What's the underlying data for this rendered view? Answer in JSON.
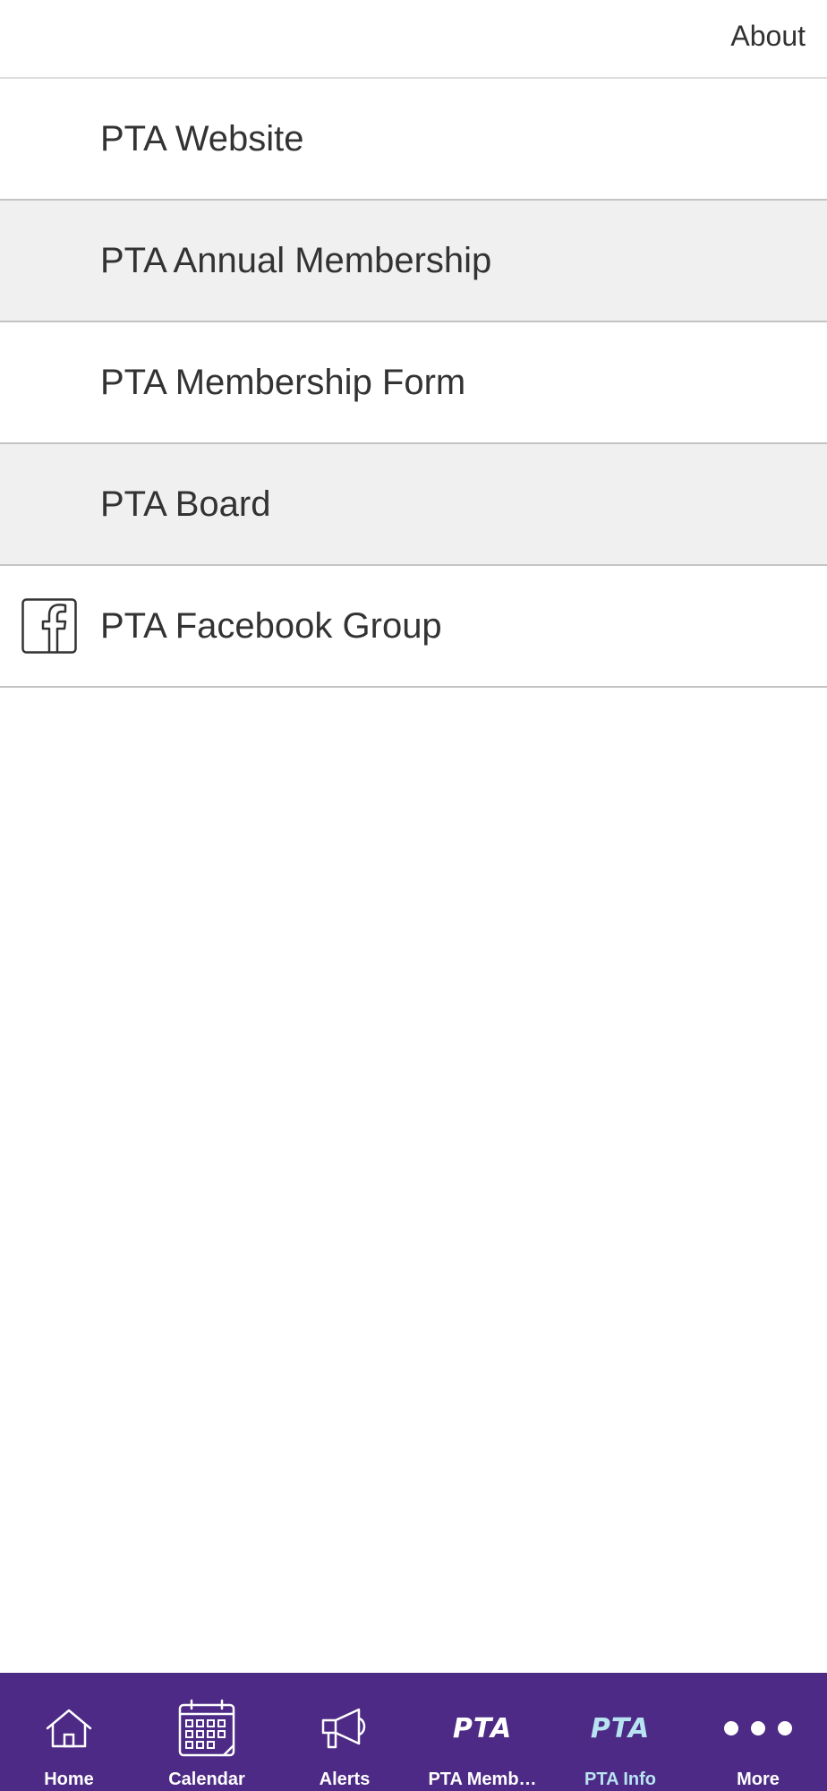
{
  "header": {
    "about_label": "About"
  },
  "list": {
    "items": [
      {
        "label": "PTA Website"
      },
      {
        "label": "PTA Annual Membership"
      },
      {
        "label": "PTA Membership Form"
      },
      {
        "label": "PTA Board"
      },
      {
        "label": "PTA Facebook Group",
        "icon": "facebook-icon"
      }
    ]
  },
  "tab_bar": {
    "background": "#4d2a85",
    "active_color": "#b8e4f2",
    "tabs": [
      {
        "label": "Home",
        "icon": "home-icon"
      },
      {
        "label": "Calendar",
        "icon": "calendar-icon"
      },
      {
        "label": "Alerts",
        "icon": "megaphone-icon"
      },
      {
        "label": "PTA Memb…",
        "icon": "pta-logo-icon",
        "logo_text": "PTA"
      },
      {
        "label": "PTA Info",
        "icon": "pta-logo-icon",
        "logo_text": "PTA",
        "active": true
      },
      {
        "label": "More",
        "icon": "more-dots-icon"
      }
    ]
  }
}
